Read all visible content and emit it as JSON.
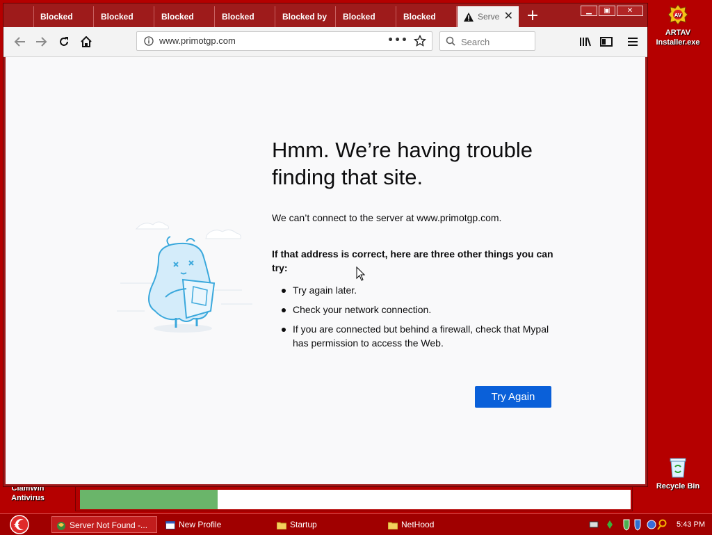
{
  "desktop": {
    "icons": [
      {
        "label_line1": "ARTAV",
        "label_line2": "Installer.exe"
      },
      {
        "label_line1": "Recycle Bin"
      },
      {
        "label_line1": "ClamWin",
        "label_line2": "Antivirus"
      }
    ]
  },
  "progress": {
    "fraction": 0.25,
    "color": "#6ab56a"
  },
  "browser": {
    "tabs": [
      {
        "label": "Blocked"
      },
      {
        "label": "Blocked"
      },
      {
        "label": "Blocked"
      },
      {
        "label": "Blocked"
      },
      {
        "label": "Blocked by"
      },
      {
        "label": "Blocked"
      },
      {
        "label": "Blocked"
      },
      {
        "label": "Serve",
        "active": true,
        "icon": "warning-icon"
      }
    ],
    "new_tab_label": "+",
    "url": "www.primotgp.com",
    "search_placeholder": "Search",
    "page_actions_label": "•••"
  },
  "error_page": {
    "title": "Hmm. We’re having trouble finding that site.",
    "description": "We can’t connect to the server at www.primotgp.com.",
    "suggestion_heading": "If that address is correct, here are three other things you can try:",
    "suggestions": [
      "Try again later.",
      "Check your network connection.",
      "If you are connected but behind a firewall, check that Mypal has permission to access the Web."
    ],
    "try_again_label": "Try Again",
    "accent_color": "#0a60d9"
  },
  "taskbar": {
    "items": [
      {
        "label": "Server Not Found -...",
        "active": true
      },
      {
        "label": "New Profile"
      },
      {
        "label": "Startup"
      },
      {
        "label": "NetHood"
      }
    ],
    "clock": "5:43 PM"
  }
}
